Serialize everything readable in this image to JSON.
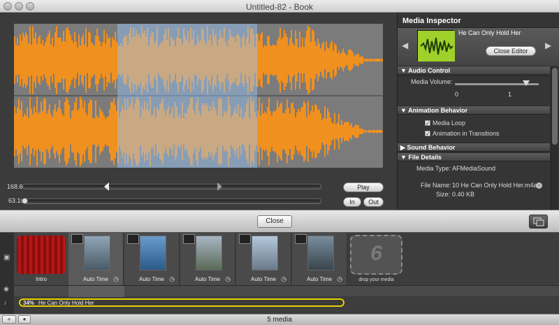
{
  "window": {
    "title": "Untitled-82 - Book"
  },
  "editor": {
    "time_a": "168.6s",
    "time_b": "63.1s",
    "play_label": "Play",
    "in_label": "In",
    "out_label": "Out"
  },
  "inspector": {
    "title": "Media Inspector",
    "media_name": "He Can Only Hold Her",
    "close_editor_label": "Close Editor",
    "audio_control": {
      "header": "Audio Control",
      "volume_label": "Media Volume:",
      "volume_min": "0",
      "volume_max": "1",
      "volume_value": 0.85
    },
    "animation_behavior": {
      "header": "Animation Behavior",
      "media_loop_label": "Media Loop",
      "media_loop_checked": true,
      "transitions_label": "Animation in Transitions",
      "transitions_checked": true
    },
    "sound_behavior": {
      "header": "Sound Behavior"
    },
    "file_details": {
      "header": "File Details",
      "media_type_label": "Media Type:",
      "media_type_value": "AFMediaSound",
      "file_name_label": "File Name:",
      "file_name_value": "10 He Can Only Hold Her.m4a",
      "size_label": "Size:",
      "size_value": "0.40 KB"
    }
  },
  "toolbar": {
    "close_label": "Close"
  },
  "timeline": {
    "intro_label": "Intro",
    "slots": [
      {
        "label": "Auto Time"
      },
      {
        "label": "Auto Time"
      },
      {
        "label": "Auto Time"
      },
      {
        "label": "Auto Time"
      },
      {
        "label": "Auto Time"
      }
    ],
    "drop_number": "6",
    "drop_label": "drop your media",
    "audio_percent": "34%",
    "audio_name": "He Can Only Hold Her"
  },
  "status": {
    "text": "5 media"
  },
  "colors": {
    "waveform": "#f0901f",
    "selection": "#96c8ff",
    "highlight": "#e8d000"
  }
}
